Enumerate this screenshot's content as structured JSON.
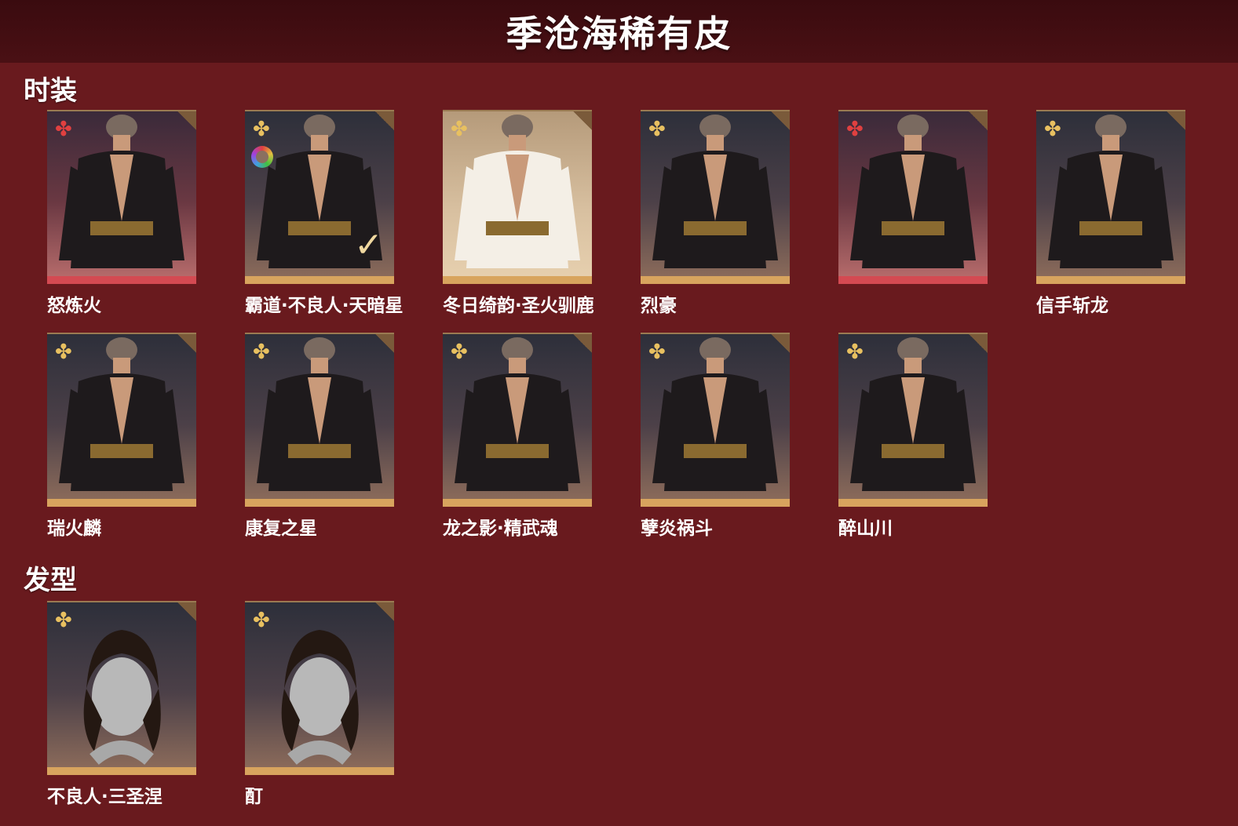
{
  "title": "季沧海稀有皮",
  "sections": [
    {
      "title": "时装",
      "items": [
        {
          "name": "怒炼火",
          "rarity": "red",
          "badge_icon": "red-flower-icon"
        },
        {
          "name": "霸道·不良人·天暗星",
          "rarity": "gold",
          "badge_icon": "gold-flower-icon",
          "dyeable": true,
          "owned": true
        },
        {
          "name": "冬日绮韵·圣火驯鹿",
          "rarity": "gold",
          "badge_icon": "gold-flower-icon"
        },
        {
          "name": "烈豪",
          "rarity": "gold",
          "badge_icon": "gold-flower-icon"
        },
        {
          "name": "",
          "rarity": "red",
          "badge_icon": "red-flower-icon"
        },
        {
          "name": "信手斩龙",
          "rarity": "gold",
          "badge_icon": "gold-flower-icon"
        },
        {
          "name": "瑞火麟",
          "rarity": "gold",
          "badge_icon": "gold-flower-icon"
        },
        {
          "name": "康复之星",
          "rarity": "gold",
          "badge_icon": "gold-flower-icon"
        },
        {
          "name": "龙之影·精武魂",
          "rarity": "gold",
          "badge_icon": "gold-flower-icon"
        },
        {
          "name": "孽炎祸斗",
          "rarity": "gold",
          "badge_icon": "gold-flower-icon"
        },
        {
          "name": "醉山川",
          "rarity": "gold",
          "badge_icon": "gold-flower-icon"
        }
      ]
    },
    {
      "title": "发型",
      "items": [
        {
          "name": "不良人·三圣涅",
          "rarity": "gold",
          "badge_icon": "gold-flower-icon"
        },
        {
          "name": "酊",
          "rarity": "gold",
          "badge_icon": "gold-flower-icon"
        }
      ]
    }
  ],
  "colors": {
    "background": "#691a1e",
    "header": "#3a0b0f",
    "gold_rarity": "#d8a45e",
    "red_rarity": "#d44a52"
  }
}
